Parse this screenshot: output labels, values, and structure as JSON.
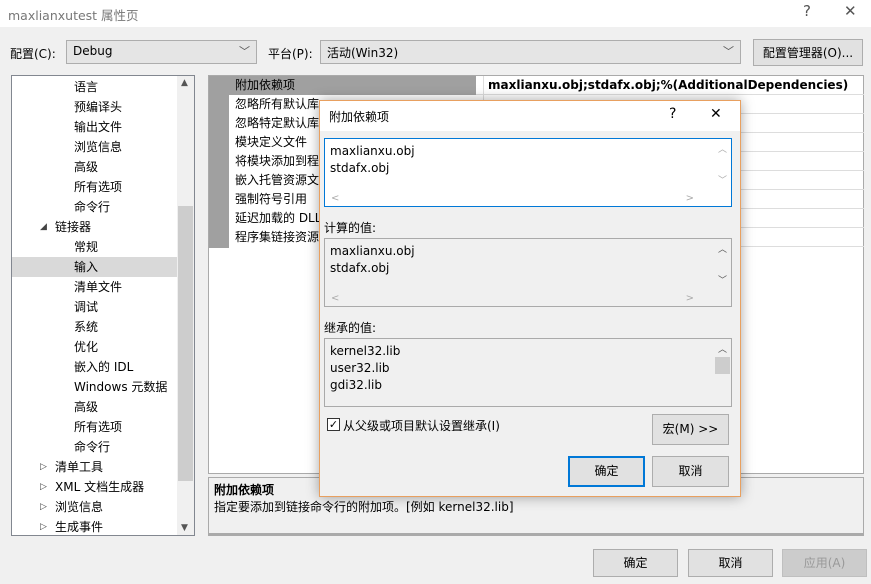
{
  "window": {
    "title": "maxlianxutest 属性页",
    "help": "?",
    "close": "✕"
  },
  "config": {
    "label": "配置(C):",
    "value": "Debug",
    "platform_label": "平台(P):",
    "platform_value": "活动(Win32)",
    "manager_button": "配置管理器(O)..."
  },
  "tree": {
    "items": [
      {
        "label": "语言",
        "level": 2
      },
      {
        "label": "预编译头",
        "level": 2
      },
      {
        "label": "输出文件",
        "level": 2
      },
      {
        "label": "浏览信息",
        "level": 2
      },
      {
        "label": "高级",
        "level": 2
      },
      {
        "label": "所有选项",
        "level": 2
      },
      {
        "label": "命令行",
        "level": 2
      },
      {
        "label": "链接器",
        "level": 1,
        "expanded": true
      },
      {
        "label": "常规",
        "level": 2
      },
      {
        "label": "输入",
        "level": 2,
        "selected": true
      },
      {
        "label": "清单文件",
        "level": 2
      },
      {
        "label": "调试",
        "level": 2
      },
      {
        "label": "系统",
        "level": 2
      },
      {
        "label": "优化",
        "level": 2
      },
      {
        "label": "嵌入的 IDL",
        "level": 2
      },
      {
        "label": "Windows 元数据",
        "level": 2
      },
      {
        "label": "高级",
        "level": 2
      },
      {
        "label": "所有选项",
        "level": 2
      },
      {
        "label": "命令行",
        "level": 2
      },
      {
        "label": "清单工具",
        "level": 1
      },
      {
        "label": "XML 文档生成器",
        "level": 1
      },
      {
        "label": "浏览信息",
        "level": 1
      },
      {
        "label": "生成事件",
        "level": 1
      }
    ]
  },
  "grid": {
    "rows": [
      {
        "name": "附加依赖项",
        "value": "maxlianxu.obj;stdafx.obj;%(AdditionalDependencies)"
      },
      {
        "name": "忽略所有默认库",
        "value": ""
      },
      {
        "name": "忽略特定默认库",
        "value": ""
      },
      {
        "name": "模块定义文件",
        "value": ""
      },
      {
        "name": "将模块添加到程序集",
        "value": ""
      },
      {
        "name": "嵌入托管资源文件",
        "value": ""
      },
      {
        "name": "强制符号引用",
        "value": ""
      },
      {
        "name": "延迟加载的 DLL",
        "value": ""
      },
      {
        "name": "程序集链接资源",
        "value": ""
      }
    ]
  },
  "description": {
    "title": "附加依赖项",
    "text": "指定要添加到链接命令行的附加项。[例如 kernel32.lib]"
  },
  "footer": {
    "ok": "确定",
    "cancel": "取消",
    "apply": "应用(A)"
  },
  "dialog": {
    "title": "附加依赖项",
    "help": "?",
    "close": "✕",
    "edit_lines": [
      "maxlianxu.obj",
      "stdafx.obj"
    ],
    "computed_label": "计算的值:",
    "computed_lines": [
      "maxlianxu.obj",
      "stdafx.obj"
    ],
    "inherited_label": "继承的值:",
    "inherited_lines": [
      "kernel32.lib",
      "user32.lib",
      "gdi32.lib"
    ],
    "inherit_checkbox": "从父级或项目默认设置继承(I)",
    "inherit_checked": true,
    "macro_button": "宏(M) >>",
    "ok": "确定",
    "cancel": "取消"
  }
}
